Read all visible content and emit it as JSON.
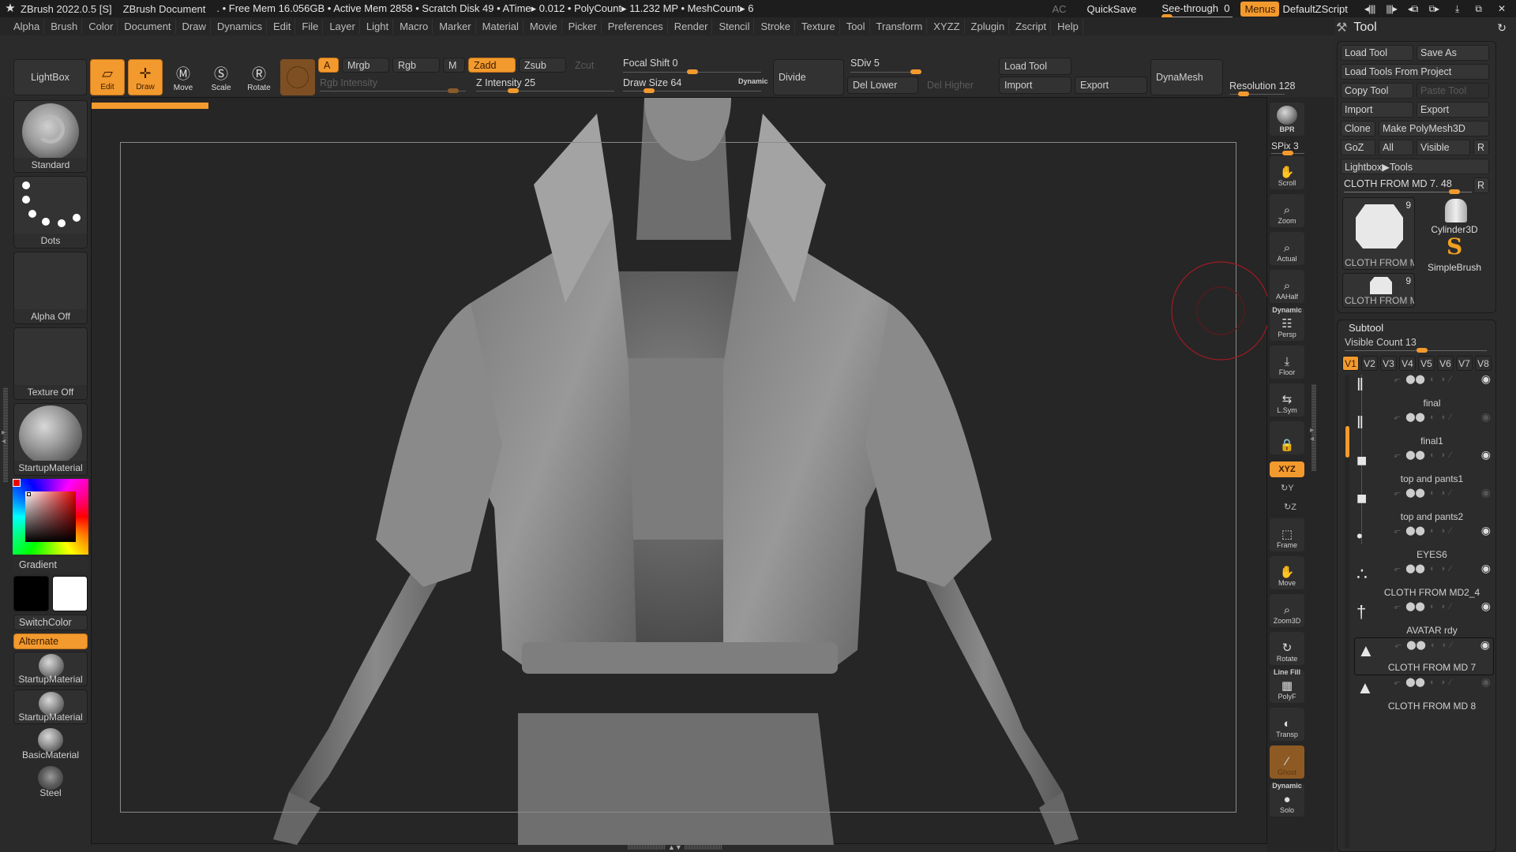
{
  "titlebar": {
    "app": "ZBrush 2022.0.5 [S]",
    "document": "ZBrush Document",
    "stats": ". • Free Mem 16.056GB • Active Mem 2858 • Scratch Disk 49 •  ATime▸ 0.012 • PolyCount▸ 11.232 MP  • MeshCount▸ 6",
    "ac": "AC",
    "quicksave": "QuickSave",
    "see_through_label": "See-through",
    "see_through_value": "0",
    "see_through_fraction": 0,
    "menus": "Menus",
    "default_zscript": "DefaultZScript"
  },
  "menubar": [
    "Alpha",
    "Brush",
    "Color",
    "Document",
    "Draw",
    "Dynamics",
    "Edit",
    "File",
    "Layer",
    "Light",
    "Macro",
    "Marker",
    "Material",
    "Movie",
    "Picker",
    "Preferences",
    "Render",
    "Stencil",
    "Stroke",
    "Texture",
    "Tool",
    "Transform",
    "XYZZ",
    "Zplugin",
    "Zscript",
    "Help"
  ],
  "toolbar": {
    "lightbox": "LightBox",
    "edit": "Edit",
    "draw": "Draw",
    "move": "Move",
    "scale": "Scale",
    "rotate": "Rotate",
    "a": "A",
    "mrgb": "Mrgb",
    "rgb": "Rgb",
    "m": "M",
    "zadd": "Zadd",
    "zsub": "Zsub",
    "zcut": "Zcut",
    "rgb_intensity": "Rgb Intensity",
    "rgb_intensity_fraction": 0.95,
    "z_intensity": "Z Intensity 25",
    "z_intensity_fraction": 0.25,
    "focal_shift": "Focal Shift 0",
    "focal_shift_fraction": 0.5,
    "draw_size": "Draw Size 64",
    "draw_size_fraction": 0.16,
    "dynamic": "Dynamic",
    "divide": "Divide",
    "sdiv": "SDiv 5",
    "sdiv_fraction": 1.0,
    "del_lower": "Del Lower",
    "del_higher": "Del Higher",
    "load_tool": "Load Tool",
    "import": "Import",
    "export": "Export",
    "dynamesh": "DynaMesh",
    "resolution": "Resolution 128",
    "resolution_fraction": 0.2
  },
  "left_shelf": {
    "brush": "Standard",
    "stroke": "Dots",
    "alpha": "Alpha Off",
    "texture": "Texture Off",
    "material": "StartupMaterial",
    "gradient": "Gradient",
    "switch_color": "SwitchColor",
    "alternate": "Alternate",
    "materials": [
      "StartupMaterial",
      "StartupMaterial",
      "BasicMaterial",
      "Steel"
    ],
    "main_color": "#000000",
    "secondary_color": "#ffffff"
  },
  "canvas": {
    "progress_fraction": 0.12
  },
  "nav_shelf": {
    "bpr": "BPR",
    "spix": "SPix 3",
    "spix_fraction": 0.5,
    "items": [
      {
        "label": "Scroll",
        "icon": "✋"
      },
      {
        "label": "Zoom",
        "icon": "⌕"
      },
      {
        "label": "Actual",
        "icon": "⌕"
      },
      {
        "label": "AAHalf",
        "icon": "⌕"
      },
      {
        "label": "Persp",
        "icon": "☷",
        "top": "Dynamic"
      },
      {
        "label": "Floor",
        "icon": "⤓"
      },
      {
        "label": "L.Sym",
        "icon": "⇆"
      },
      {
        "label": "",
        "icon": "🔒"
      }
    ],
    "xyz": "XYZ",
    "y": "Y",
    "z": "Z",
    "items2": [
      {
        "label": "Frame",
        "icon": "⬚"
      },
      {
        "label": "Move",
        "icon": "✋"
      },
      {
        "label": "Zoom3D",
        "icon": "⌕"
      },
      {
        "label": "Rotate",
        "icon": "↻"
      },
      {
        "label": "PolyF",
        "icon": "▦",
        "top": "Line Fill"
      },
      {
        "label": "Transp",
        "icon": "◐"
      },
      {
        "label": "Ghost",
        "icon": "∕"
      },
      {
        "label": "Solo",
        "icon": "●",
        "top": "Dynamic"
      }
    ]
  },
  "tool_panel": {
    "title": "Tool",
    "buttons": {
      "load_tool": "Load Tool",
      "save_as": "Save As",
      "load_from_project": "Load Tools From Project",
      "copy_tool": "Copy Tool",
      "paste_tool": "Paste Tool",
      "import": "Import",
      "export": "Export",
      "clone": "Clone",
      "make_polymesh": "Make PolyMesh3D",
      "goz": "GoZ",
      "all": "All",
      "visible": "Visible",
      "r": "R",
      "lightbox_tools": "Lightbox▶Tools"
    },
    "current_tool": "CLOTH FROM MD 7. 48",
    "current_tool_fraction": 0.9,
    "thumbs": [
      {
        "label": "CLOTH FROM MD",
        "count": "9"
      },
      {
        "label": "Cylinder3D"
      },
      {
        "label": "SimpleBrush"
      },
      {
        "label": "CLOTH FROM MD",
        "count": "9"
      }
    ]
  },
  "subtool": {
    "title": "Subtool",
    "visible_count": "Visible Count 13",
    "visible_count_fraction": 0.55,
    "tabs": [
      "V1",
      "V2",
      "V3",
      "V4",
      "V5",
      "V6",
      "V7",
      "V8"
    ],
    "active_tab": "V1",
    "items": [
      {
        "name": "final",
        "visible": true,
        "icon": "‖"
      },
      {
        "name": "final1",
        "visible": false,
        "icon": "‖"
      },
      {
        "name": "top and pants1",
        "visible": true,
        "icon": "■"
      },
      {
        "name": "top and pants2",
        "visible": false,
        "icon": "■"
      },
      {
        "name": "EYES6",
        "visible": true,
        "icon": "•"
      },
      {
        "name": "CLOTH FROM MD2_4",
        "visible": true,
        "icon": "∴"
      },
      {
        "name": "AVATAR rdy",
        "visible": true,
        "icon": "†"
      },
      {
        "name": "CLOTH FROM MD 7",
        "visible": true,
        "icon": "▲",
        "selected": true
      },
      {
        "name": "CLOTH FROM MD 8",
        "visible": false,
        "icon": "▲"
      }
    ]
  }
}
